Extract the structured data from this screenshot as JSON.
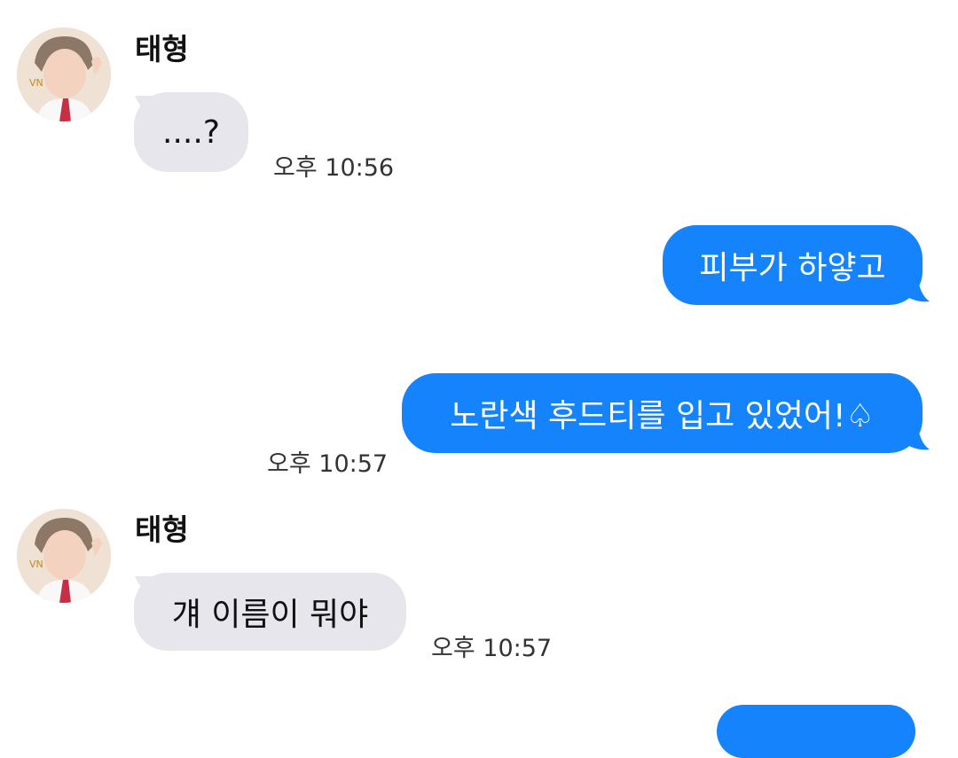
{
  "conversation": {
    "messages": [
      {
        "sender": "태형",
        "direction": "incoming",
        "text": "....?",
        "time": "오후 10:56"
      },
      {
        "direction": "outgoing",
        "text": "피부가 하얗고"
      },
      {
        "direction": "outgoing",
        "text": "노란색 후드티를 입고 있었어!♤",
        "time": "오후 10:57"
      },
      {
        "sender": "태형",
        "direction": "incoming",
        "text": "걔 이름이 뭐야",
        "time": "오후 10:57"
      },
      {
        "direction": "outgoing",
        "text": ""
      }
    ]
  },
  "colors": {
    "incoming_bubble": "#e6e6ec",
    "outgoing_bubble": "#1584fc"
  },
  "icons": {
    "avatar": "contact-avatar-photo"
  }
}
